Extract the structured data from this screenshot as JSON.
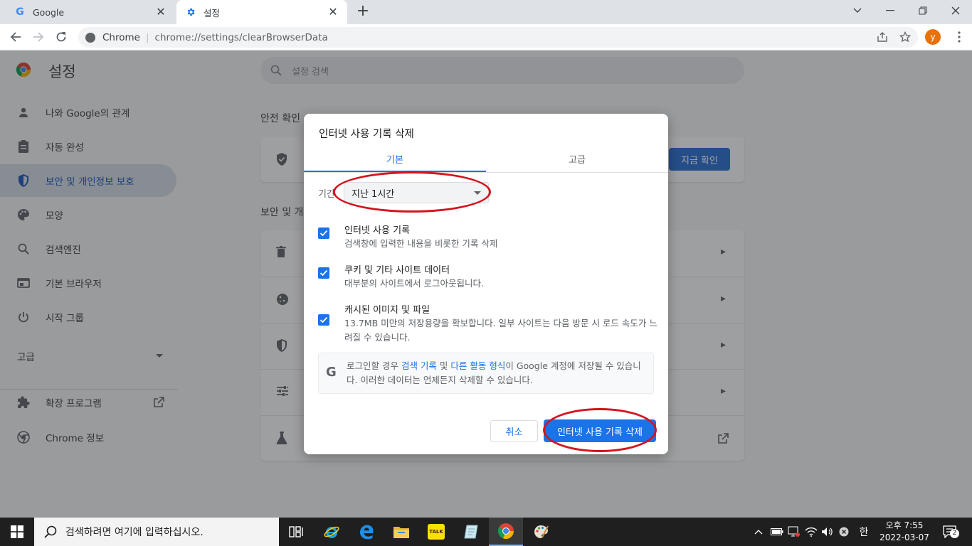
{
  "browser": {
    "tabs": [
      {
        "title": "Google",
        "favicon": "G"
      },
      {
        "title": "설정",
        "favicon": "gear-icon"
      }
    ],
    "address": {
      "origin": "Chrome",
      "separator": "|",
      "url": "chrome://settings/clearBrowserData"
    },
    "profile_initial": "y"
  },
  "settings": {
    "title": "설정",
    "search_placeholder": "설정 검색",
    "sidebar": [
      {
        "label": "나와 Google의 관계",
        "icon": "person-icon"
      },
      {
        "label": "자동 완성",
        "icon": "clipboard-icon"
      },
      {
        "label": "보안 및 개인정보 보호",
        "icon": "shield-icon"
      },
      {
        "label": "모양",
        "icon": "palette-icon"
      },
      {
        "label": "검색엔진",
        "icon": "search-icon"
      },
      {
        "label": "기본 브라우저",
        "icon": "browser-icon"
      },
      {
        "label": "시작 그룹",
        "icon": "power-icon"
      }
    ],
    "advanced_label": "고급",
    "extensions_label": "확장 프로그램",
    "about_label": "Chrome 정보",
    "safety_check_heading": "안전 확인",
    "safety_check_button": "지금 확인",
    "privacy_heading": "보안 및 개"
  },
  "dialog": {
    "title": "인터넷 사용 기록 삭제",
    "tabs": [
      "기본",
      "고급"
    ],
    "period_label": "기간",
    "period_value": "지난 1시간",
    "options": [
      {
        "title": "인터넷 사용 기록",
        "desc": "검색창에 입력한 내용을 비롯한 기록 삭제",
        "checked": true
      },
      {
        "title": "쿠키 및 기타 사이트 데이터",
        "desc": "대부분의 사이트에서 로그아웃됩니다.",
        "checked": true
      },
      {
        "title": "캐시된 이미지 및 파일",
        "desc": "13.7MB 미만의 저장용량을 확보합니다. 일부 사이트는 다음 방문 시 로드 속도가 느려질 수 있습니다.",
        "checked": true
      }
    ],
    "info": {
      "pre": "로그인할 경우 ",
      "link1": "검색 기록",
      "mid": " 및 ",
      "link2": "다른 활동 형식",
      "post": "이 Google 계정에 저장될 수 있습니다. 이러한 데이터는 언제든지 삭제할 수 있습니다."
    },
    "cancel_label": "취소",
    "confirm_label": "인터넷 사용 기록 삭제"
  },
  "taskbar": {
    "search_placeholder": "검색하려면 여기에 입력하십시오.",
    "ime": "한",
    "time": "오후 7:55",
    "date": "2022-03-07",
    "notification_count": "2",
    "kakao_label": "TALK"
  },
  "colors": {
    "accent": "#1a73e8",
    "annotation": "#d4141e"
  }
}
